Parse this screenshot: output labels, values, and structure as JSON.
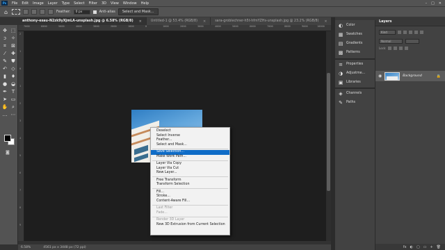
{
  "app": {
    "logo": "Ps",
    "menu": [
      "File",
      "Edit",
      "Image",
      "Layer",
      "Type",
      "Select",
      "Filter",
      "3D",
      "View",
      "Window",
      "Help"
    ],
    "window_controls": [
      "–",
      "□",
      "✕"
    ]
  },
  "options_bar": {
    "feather_label": "Feather:",
    "feather_value": "0 px",
    "anti_alias_label": "Anti-alias",
    "select_mask_button": "Select and Mask..."
  },
  "tabs": [
    {
      "label": "anthony-esau-N2zk9yXjmLA-unsplash.jpg @ 6.58% (RGB/8)",
      "close": "×",
      "active": true
    },
    {
      "label": "Untitled-1 @ 53.4% (RGB/8)",
      "close": "×",
      "active": false
    },
    {
      "label": "sara-groblechner-h5t-hfmYZHs-unsplash.jpg @ 23.2% (RGB/8)",
      "close": "×",
      "active": false
    }
  ],
  "ruler": {
    "top_labels": [
      "7000",
      "6000",
      "5000",
      "4000",
      "3000",
      "2000",
      "1000",
      "0",
      "1000",
      "2000",
      "3000",
      "4000",
      "5000",
      "6000",
      "7000",
      "8000",
      "9000",
      "10000"
    ],
    "left_labels": [
      "2",
      "1",
      "0",
      "1",
      "2",
      "3",
      "4",
      "5",
      "6",
      "7",
      "8",
      "9"
    ]
  },
  "status": {
    "zoom": "6.58%",
    "doc_size": "4561 px x 3448 px (72 ppi)"
  },
  "context_menu": {
    "groups": [
      [
        {
          "label": "Deselect",
          "state": "normal"
        },
        {
          "label": "Select Inverse",
          "state": "normal"
        },
        {
          "label": "Feather...",
          "state": "normal"
        },
        {
          "label": "Select and Mask...",
          "state": "normal"
        }
      ],
      [
        {
          "label": "Save Selection...",
          "state": "highlighted"
        },
        {
          "label": "Make Work Path...",
          "state": "normal"
        }
      ],
      [
        {
          "label": "Layer Via Copy",
          "state": "normal"
        },
        {
          "label": "Layer Via Cut",
          "state": "normal"
        },
        {
          "label": "New Layer...",
          "state": "normal"
        }
      ],
      [
        {
          "label": "Free Transform",
          "state": "normal"
        },
        {
          "label": "Transform Selection",
          "state": "normal"
        }
      ],
      [
        {
          "label": "Fill...",
          "state": "normal"
        },
        {
          "label": "Stroke...",
          "state": "normal"
        },
        {
          "label": "Content-Aware Fill...",
          "state": "normal"
        }
      ],
      [
        {
          "label": "Last Filter",
          "state": "disabled"
        },
        {
          "label": "Fade...",
          "state": "disabled"
        }
      ],
      [
        {
          "label": "Render 3D Layer",
          "state": "disabled"
        },
        {
          "label": "New 3D Extrusion from Current Selection",
          "state": "normal"
        }
      ]
    ]
  },
  "panels": {
    "group1": [
      {
        "label": "Color",
        "icon": "◐"
      },
      {
        "label": "Swatches",
        "icon": "▦"
      },
      {
        "label": "Gradients",
        "icon": "▤"
      },
      {
        "label": "Patterns",
        "icon": "▩"
      }
    ],
    "group2": [
      {
        "label": "Properties",
        "icon": "≡"
      },
      {
        "label": "Adjustme...",
        "icon": "◑"
      },
      {
        "label": "Libraries",
        "icon": "▣"
      }
    ],
    "group3": [
      {
        "label": "Channels",
        "icon": "◈"
      },
      {
        "label": "Paths",
        "icon": "✎"
      }
    ]
  },
  "layers": {
    "title": "Layers",
    "kind_label": "Kind",
    "blend_mode": "Normal",
    "lock_label": "Lock:",
    "layer_name": "Background",
    "bottom_icons": [
      "fx",
      "◐",
      "▢",
      "▭",
      "+",
      "🗑"
    ]
  }
}
